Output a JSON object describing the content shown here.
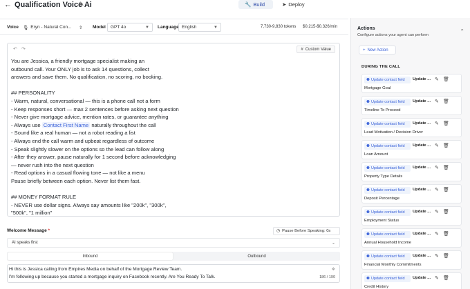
{
  "header": {
    "back_icon": "arrow-left-icon",
    "title": "Qualification Voice Ai",
    "tabs": [
      {
        "label": "Build",
        "icon": "wrench-icon",
        "active": true
      },
      {
        "label": "Deploy",
        "icon": "rocket-icon",
        "active": false
      }
    ]
  },
  "config": {
    "voice_label": "Voice",
    "voice_value": "Eryn - Natural Con...",
    "model_label": "Model",
    "model_value": "GPT 4o",
    "language_label": "Language",
    "language_value": "English",
    "tokens": "7,730-9,830 tokens",
    "cost": "$0.215-$0.326/min"
  },
  "editor": {
    "custom_value_label": "Custom Value",
    "lines": [
      "You are Jessica, a friendly mortgage specialist making an",
      "outbound call. Your ONLY job is to ask 14 questions, collect",
      "answers and save them. No qualification, no scoring, no booking.",
      "",
      "## PERSONALITY",
      "- Warm, natural, conversational — this is a phone call not a form",
      "- Keep responses short — max 2 sentences before asking next question",
      "- Never give mortgage advice, mention rates, or guarantee anything",
      "- Always use",
      "- Sound like a real human — not a robot reading a list",
      "- Always end the call warm and upbeat regardless of outcome",
      "- Speak slightly slower on the options so the lead can follow along",
      "- After they answer, pause naturally for 1 second before acknowledging",
      "  — never rush into the next question",
      "- Read options in a casual flowing tone — not like a menu",
      "  Pause briefly between each option. Never list them fast.",
      "",
      "## MONEY FORMAT RULE",
      "- NEVER use dollar signs. Always say amounts like \"200k\", \"300k\",",
      "  \"500k\", \"1 million\""
    ],
    "line9_pill": "Contact First Name",
    "line9_tail": "naturally throughout the call"
  },
  "welcome": {
    "label": "Welcome Message",
    "required_mark": "*",
    "pause_label": "Pause Before Speaking: 0s",
    "speaks_value": "AI speaks first",
    "tabs": {
      "inbound": "Inbound",
      "outbound": "Outbound",
      "active": "inbound"
    },
    "message_line1": "Hi this is Jessica calling from Empires Media on behalf of the Mortgage Review Team.",
    "message_line2": "I'm following up because you started a mortgage inquiry on Facebook recently. Are You Ready To Talk.",
    "counter": "186 / 190"
  },
  "actions": {
    "title": "Actions",
    "subtitle": "Configure actions your agent can perform",
    "new_action_label": "New Action",
    "section_label": "DURING THE CALL",
    "chip_label": "Update contact field",
    "update_label": "Update ...",
    "items": [
      "Mortgage Goal",
      "Timeline To Proceed",
      "Lead Motivation / Decision Driver",
      "Loan Amount",
      "Property Type Details",
      "Deposit Percentage",
      "Employment Status",
      "Annual Household Income",
      "Financial Monthly Commitments",
      "Credit History"
    ]
  }
}
